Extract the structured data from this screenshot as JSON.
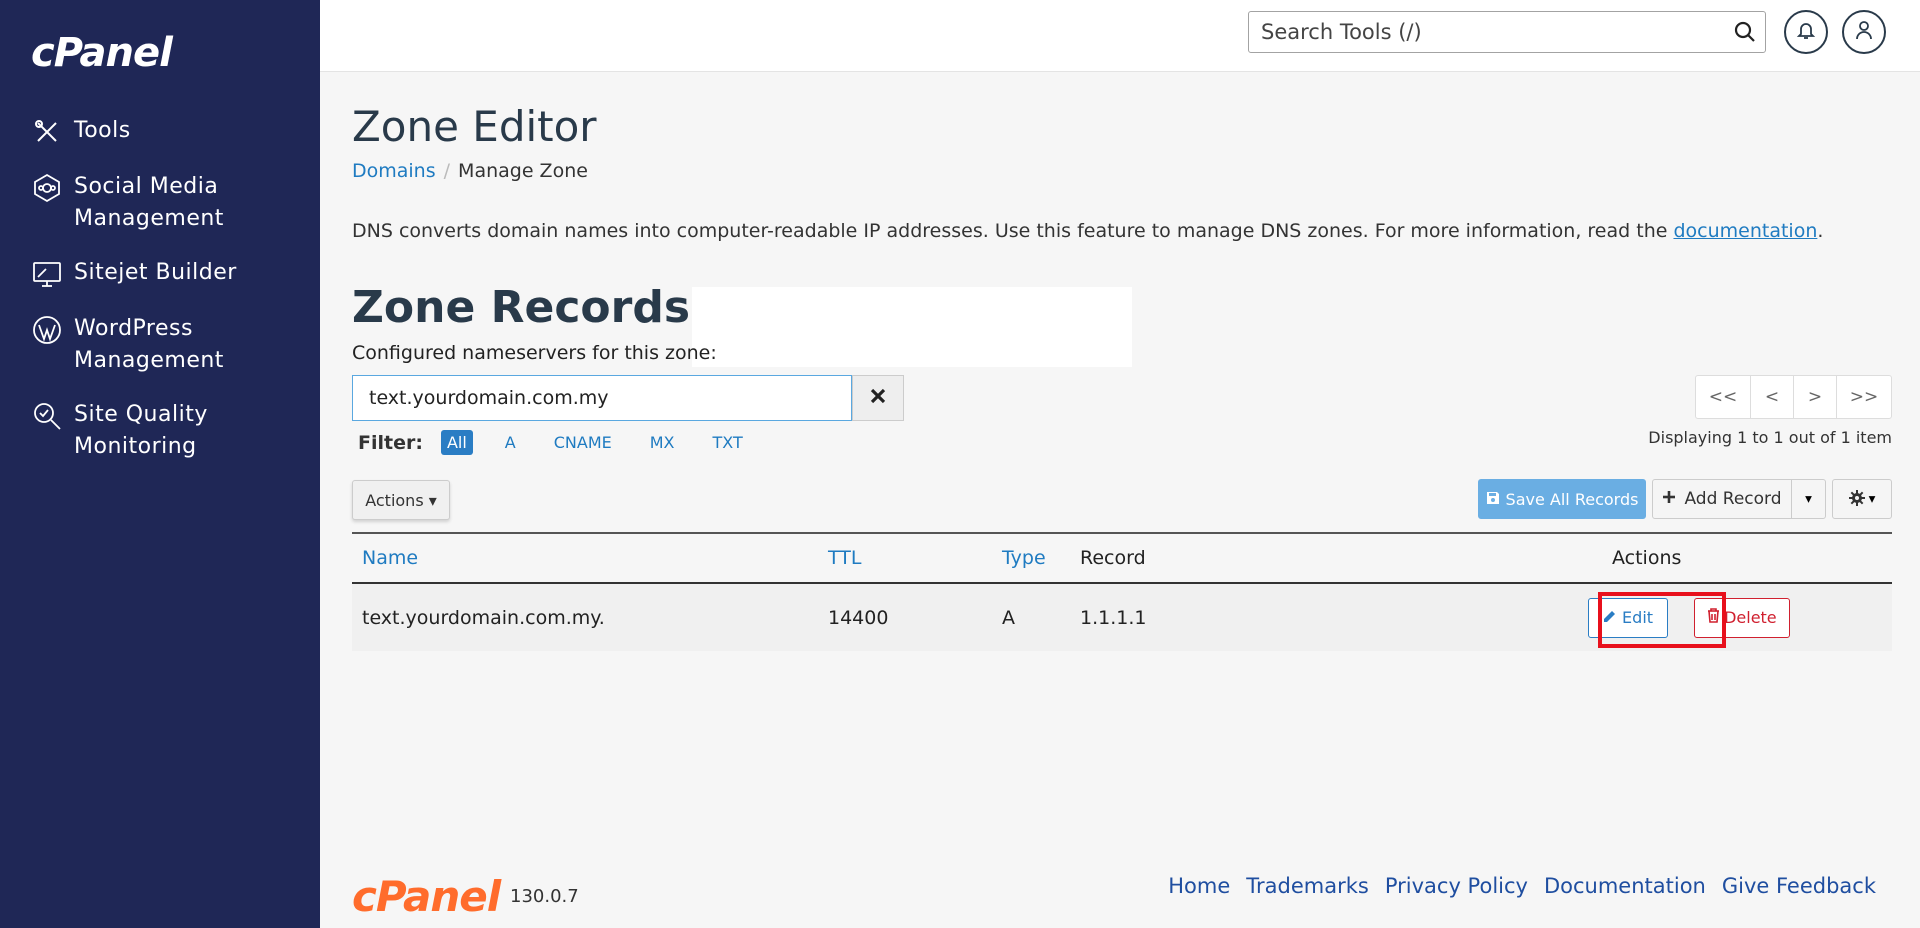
{
  "sidebar": {
    "brand": "cPanel",
    "items": [
      {
        "label": "Tools",
        "icon": "tools-icon"
      },
      {
        "label": "Social Media Management",
        "icon": "social-media-icon"
      },
      {
        "label": "Sitejet Builder",
        "icon": "sitejet-icon"
      },
      {
        "label": "WordPress Management",
        "icon": "wordpress-icon"
      },
      {
        "label": "Site Quality Monitoring",
        "icon": "site-quality-icon"
      }
    ]
  },
  "topbar": {
    "search_placeholder": "Search Tools (/)"
  },
  "page": {
    "title": "Zone Editor",
    "breadcrumb": {
      "parent": "Domains",
      "current": "Manage Zone"
    },
    "description": "DNS converts domain names into computer-readable IP addresses. Use this feature to manage DNS zones. For more information, read the ",
    "description_link": "documentation",
    "description_end": ".",
    "zone_title": "Zone Records for ‘",
    "nameservers_label": "Configured nameservers for this zone:"
  },
  "filter": {
    "search_value": "text.yourdomain.com.my",
    "label": "Filter:",
    "types": [
      "All",
      "A",
      "CNAME",
      "MX",
      "TXT"
    ],
    "active": "All"
  },
  "pager": {
    "first": "<<",
    "prev": "<",
    "next": ">",
    "last": ">>",
    "info": "Displaying 1 to 1 out of 1 item"
  },
  "toolbar": {
    "actions": "Actions",
    "save_all": "Save All Records",
    "add_record": "Add Record"
  },
  "table": {
    "headers": {
      "name": "Name",
      "ttl": "TTL",
      "type": "Type",
      "record": "Record",
      "actions": "Actions"
    },
    "rows": [
      {
        "name": "text.yourdomain.com.my.",
        "ttl": "14400",
        "type": "A",
        "record": "1.1.1.1",
        "edit": "Edit",
        "delete": "Delete"
      }
    ]
  },
  "footer": {
    "logo": "cPanel",
    "version": "130.0.7",
    "links": [
      "Home",
      "Trademarks",
      "Privacy Policy",
      "Documentation",
      "Give Feedback"
    ]
  },
  "colors": {
    "sidebar_bg": "#1f2756",
    "link": "#1f7bc1",
    "brand_orange": "#ff6c2c",
    "highlight": "#e8101c",
    "delete": "#d0202f"
  }
}
